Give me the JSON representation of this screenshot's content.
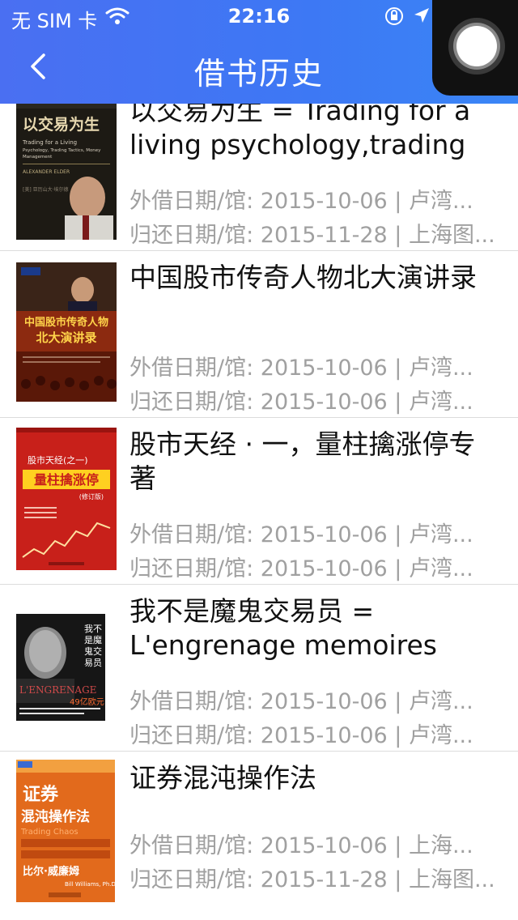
{
  "status_bar": {
    "carrier": "无 SIM 卡",
    "time": "22:16"
  },
  "nav": {
    "title": "借书历史"
  },
  "books": [
    {
      "title": "以交易为生 = Trading for a living psychology,trading t...",
      "borrow": "外借日期/馆: 2015-10-06 | 卢湾...",
      "return": "归还日期/馆: 2015-11-28 | 上海图...",
      "cover": {
        "bg": "#1d1a14",
        "main": "以交易为生",
        "sub": "Trading for a Living\nPsychology, Trading Tactics, Money Management",
        "author": "ALEXANDER ELDER"
      }
    },
    {
      "title": "中国股市传奇人物北大演讲录",
      "borrow": "外借日期/馆: 2015-10-06 | 卢湾...",
      "return": "归还日期/馆: 2015-10-06 | 卢湾...",
      "cover": {
        "bg": "#8a2414",
        "main": "中国股市传奇人物\n北大演讲录",
        "sub": "",
        "author": ""
      }
    },
    {
      "title": "股市天经 · 一，量柱擒涨停专著",
      "borrow": "外借日期/馆: 2015-10-06 | 卢湾...",
      "return": "归还日期/馆: 2015-10-06 | 卢湾...",
      "cover": {
        "bg": "#c8201a",
        "main": "量柱擒涨停",
        "sub": "股市天经(之一)",
        "author": "(修订版)"
      }
    },
    {
      "title": "我不是魔鬼交易员 = L'engrenage memoires d'u...",
      "borrow": "外借日期/馆: 2015-10-06 | 卢湾...",
      "return": "归还日期/馆: 2015-10-06 | 卢湾...",
      "cover": {
        "bg": "#1a1a1a",
        "main": "我不是\n魔鬼\n交易员",
        "sub": "L'ENGRENAGE",
        "author": "49亿欧元"
      }
    },
    {
      "title": "证券混沌操作法",
      "borrow": "外借日期/馆: 2015-10-06 | 上海...",
      "return": "归还日期/馆: 2015-11-28 | 上海图...",
      "cover": {
        "bg": "#d85a14",
        "main": "证券\n混沌操作法",
        "sub": "Trading Chaos",
        "author": "比尔·威廉姆\nBill Williams, Ph.D."
      }
    }
  ]
}
